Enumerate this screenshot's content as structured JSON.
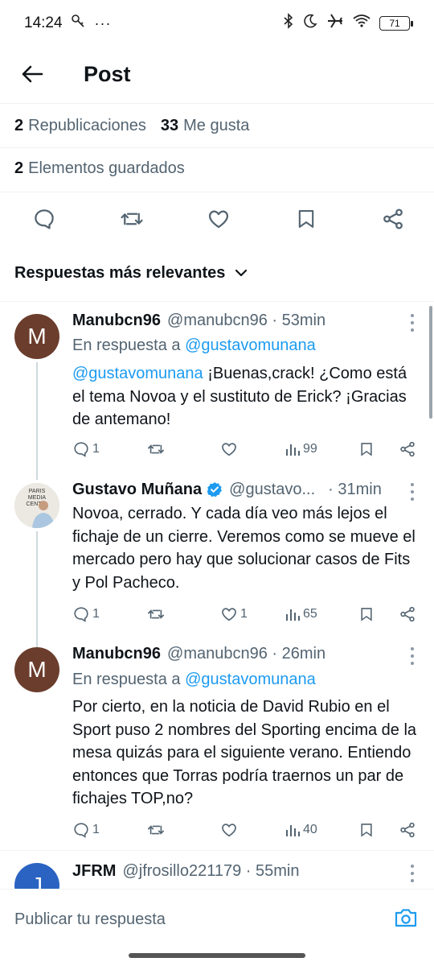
{
  "status": {
    "time": "14:24",
    "battery": "71"
  },
  "header": {
    "title": "Post"
  },
  "stats": {
    "reposts_count": "2",
    "reposts_label": "Republicaciones",
    "likes_count": "33",
    "likes_label": "Me gusta",
    "bookmarks_count": "2",
    "bookmarks_label": "Elementos guardados"
  },
  "sort": {
    "label": "Respuestas más relevantes"
  },
  "tweets": [
    {
      "name": "Manubcn96",
      "handle": "@manubcn96 · 53min",
      "avatar": "M",
      "reply_prefix": "En respuesta a",
      "reply_to": "@gustavomunana",
      "mention": "@gustavomunana",
      "text": " ¡Buenas,crack! ¿Como está el tema Novoa y el sustituto de Erick? ¡Gracias de antemano!",
      "replies": "1",
      "reposts": "",
      "likes": "",
      "views": "99"
    },
    {
      "name": "Gustavo Muñana",
      "handle": "@gustavo...",
      "time": "· 31min",
      "avatar_text": "PARIS MEDIA CENTRE",
      "text": "Novoa, cerrado. Y cada día veo más lejos el fichaje de un cierre. Veremos como se mueve el mercado pero hay que solucionar casos de Fits y Pol Pacheco.",
      "replies": "1",
      "reposts": "",
      "likes": "1",
      "views": "65"
    },
    {
      "name": "Manubcn96",
      "handle": "@manubcn96 · 26min",
      "avatar": "M",
      "reply_prefix": "En respuesta a",
      "reply_to": "@gustavomunana",
      "text": "Por cierto, en la noticia de David Rubio en el Sport puso 2 nombres del Sporting encima de la mesa quizás para el siguiente verano. Entiendo entonces que Torras podría traernos un par de fichajes TOP,no?",
      "replies": "1",
      "reposts": "",
      "likes": "",
      "views": "40"
    },
    {
      "name": "JFRM",
      "handle": "@jfrosillo221179 · 55min",
      "avatar": "J"
    }
  ],
  "composer": {
    "placeholder": "Publicar tu respuesta"
  },
  "colors": {
    "link": "#1d9bf0",
    "muted": "#536471",
    "verified": "#1d9bf0",
    "avatar_m": "#6b3d2c",
    "avatar_j": "#2a63c2"
  }
}
